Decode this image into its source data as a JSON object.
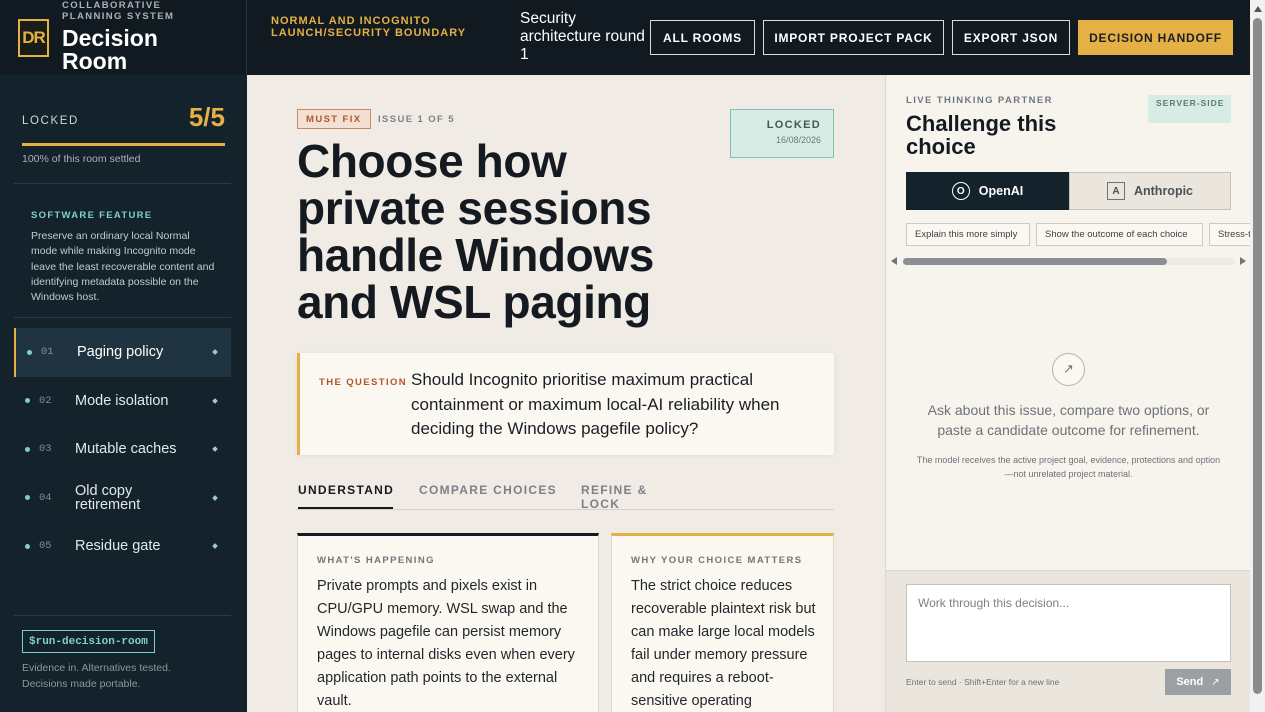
{
  "header": {
    "brand_logo": "DR",
    "brand_subtitle": "COLLABORATIVE PLANNING SYSTEM",
    "brand_title": "Decision Room",
    "boundary": "NORMAL AND INCOGNITO LAUNCH/SECURITY BOUNDARY",
    "round": "Security architecture round 1",
    "buttons": {
      "all_rooms": "ALL ROOMS",
      "import": "IMPORT PROJECT PACK",
      "export": "EXPORT JSON",
      "handoff": "DECISION HANDOFF"
    }
  },
  "sidebar": {
    "lock_label": "LOCKED",
    "lock_count": "5/5",
    "lock_progress": 1.0,
    "lock_note": "100% of this room settled",
    "feature_kicker": "SOFTWARE FEATURE",
    "feature_text": "Preserve an ordinary local Normal mode while making Incognito mode leave the least recoverable content and identifying metadata possible on the Windows host.",
    "items": [
      {
        "num": "01",
        "label": "Paging policy",
        "active": true
      },
      {
        "num": "02",
        "label": "Mode isolation",
        "active": false
      },
      {
        "num": "03",
        "label": "Mutable caches",
        "active": false
      },
      {
        "num": "04",
        "label": "Old copy retirement",
        "active": false
      },
      {
        "num": "05",
        "label": "Residue gate",
        "active": false
      }
    ],
    "command": "$run-decision-room",
    "tagline": "Evidence in. Alternatives tested. Decisions made portable."
  },
  "main": {
    "priority": "MUST FIX",
    "issue_number": "ISSUE 1 OF 5",
    "status_label": "Locked",
    "status_date": "16/08/2026",
    "title": "Choose how private sessions handle Windows and WSL paging",
    "question_kicker": "THE QUESTION",
    "question": "Should Incognito prioritise maximum practical containment or maximum local-AI reliability when deciding the Windows pagefile policy?",
    "tabs": [
      {
        "label": "UNDERSTAND",
        "active": true
      },
      {
        "label": "COMPARE CHOICES",
        "active": false
      },
      {
        "label": "REFINE & LOCK",
        "active": false
      }
    ],
    "cards": [
      {
        "kicker": "WHAT'S HAPPENING",
        "text": "Private prompts and pixels exist in CPU/GPU memory. WSL swap and the Windows pagefile can persist memory pages to internal disks even when every application path points to the external vault."
      },
      {
        "kicker": "WHY YOUR CHOICE MATTERS",
        "text": "The strict choice reduces recoverable plaintext risk but can make large local models fail under memory pressure and requires a reboot-sensitive operating"
      }
    ]
  },
  "assistant": {
    "kicker": "LIVE THINKING PARTNER",
    "title": "Challenge this choice",
    "badge": "SERVER-SIDE",
    "providers": [
      {
        "icon": "O",
        "label": "OpenAI",
        "selected": true
      },
      {
        "icon": "A",
        "label": "Anthropic",
        "selected": false
      }
    ],
    "chips": [
      "Explain this more simply",
      "Show the outcome of each choice",
      "Stress-t"
    ],
    "empty_icon": "↗",
    "empty_title": "Ask about this issue, compare two options, or paste a candidate outcome for refinement.",
    "empty_note": "The model receives the active project goal, evidence, protections and option—not unrelated project material.",
    "input_placeholder": "Work through this decision...",
    "hint": "Enter to send · Shift+Enter for a new line",
    "send_label": "Send",
    "send_icon": "↗"
  },
  "colors": {
    "accent": "#e5b044",
    "dark": "#13222b",
    "teal": "#7fd0c6",
    "danger": "#b0572a"
  }
}
